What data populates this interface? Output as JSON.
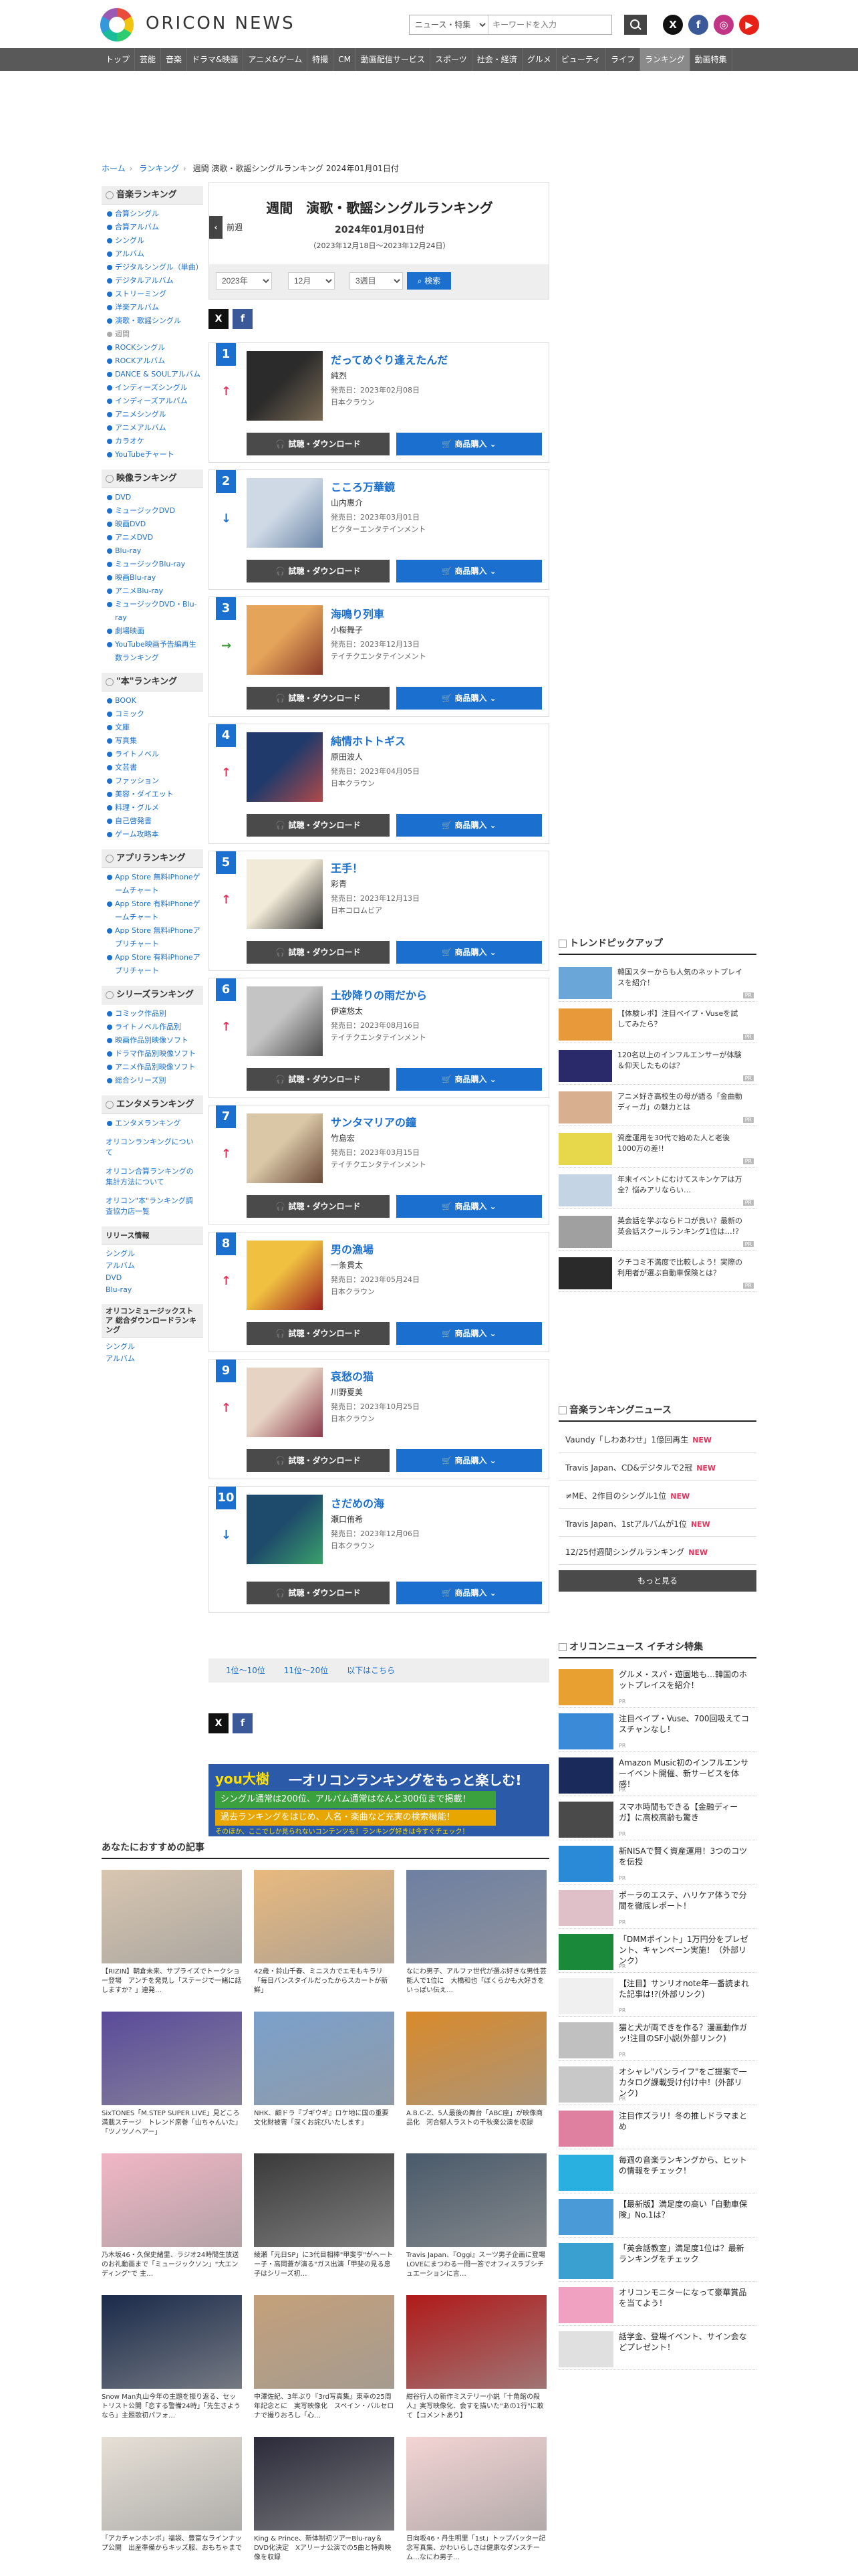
{
  "header": {
    "logo": "ORICON NEWS",
    "search_category": "ニュース・特集",
    "search_placeholder": "キーワードを入力",
    "social": [
      "X",
      "f",
      "◎",
      "▶"
    ]
  },
  "nav": [
    "トップ",
    "芸能",
    "音楽",
    "ドラマ&映画",
    "アニメ&ゲーム",
    "特撮",
    "CM",
    "動画配信サービス",
    "スポーツ",
    "社会・経済",
    "グルメ",
    "ビューティ",
    "ライフ",
    "ランキング",
    "動画特集"
  ],
  "nav_active": "ランキング",
  "breadcrumb": [
    "ホーム",
    "ランキング",
    "週間 演歌・歌謡シングルランキング 2024年01月01日付"
  ],
  "sidebar": {
    "music_head": "音楽ランキング",
    "music": [
      "合算シングル",
      "合算アルバム",
      "シングル",
      "アルバム",
      "デジタルシングル（単曲）",
      "デジタルアルバム",
      "ストリーミング",
      "洋楽アルバム",
      "演歌・歌謡シングル",
      "週間",
      "ROCKシングル",
      "ROCKアルバム",
      "DANCE & SOULアルバム",
      "インディーズシングル",
      "インディーズアルバム",
      "アニメシングル",
      "アニメアルバム",
      "カラオケ",
      "YouTubeチャート"
    ],
    "video_head": "映像ランキング",
    "video": [
      "DVD",
      "ミュージックDVD",
      "映画DVD",
      "アニメDVD",
      "Blu-ray",
      "ミュージックBlu-ray",
      "映画Blu-ray",
      "アニメBlu-ray",
      "ミュージックDVD・Blu-ray",
      "劇場映画",
      "YouTube映画予告編再生数ランキング"
    ],
    "book_head": "\"本\"ランキング",
    "book": [
      "BOOK",
      "コミック",
      "文庫",
      "写真集",
      "ライトノベル",
      "文芸書",
      "ファッション",
      "美容・ダイエット",
      "料理・グルメ",
      "自己啓発書",
      "ゲーム攻略本"
    ],
    "app_head": "アプリランキング",
    "app": [
      "App Store 無料iPhoneゲームチャート",
      "App Store 有料iPhoneゲームチャート",
      "App Store 無料iPhoneアプリチャート",
      "App Store 有料iPhoneアプリチャート"
    ],
    "series_head": "シリーズランキング",
    "series": [
      "コミック作品別",
      "ライトノベル作品別",
      "映画作品別映像ソフト",
      "ドラマ作品別映像ソフト",
      "アニメ作品別映像ソフト",
      "総合シリーズ別"
    ],
    "ent_head": "エンタメランキング",
    "ent": [
      "エンタメランキング"
    ],
    "links": [
      "オリコンランキングについて",
      "オリコン合算ランキングの集計方法について",
      "オリコン\"本\"ランキング調査協力店一覧"
    ],
    "release_head": "リリース情報",
    "release": [
      "シングル",
      "アルバム",
      "DVD",
      "Blu-ray"
    ],
    "music_store_head": "オリコンミュージックストア 総合ダウンロードランキング",
    "music_store": [
      "シングル",
      "アルバム"
    ]
  },
  "main": {
    "title": "週間　演歌・歌謡シングルランキング",
    "date": "2024年01月01日付",
    "range": "（2023年12月18日〜2023年12月24日）",
    "prev": "前週",
    "year": "2023年",
    "month": "12月",
    "week": "3週目",
    "search_btn": "検索",
    "dl_label": "試聴・ダウンロード",
    "buy_label": "商品購入",
    "pager": [
      "1位〜10位",
      "11位〜20位",
      "以下はこちら"
    ]
  },
  "ranking": [
    {
      "rank": "1",
      "title": "だってめぐり逢えたんだ",
      "artist": "純烈",
      "date": "発売日：2023年02月08日",
      "label": "日本クラウン",
      "move": "up"
    },
    {
      "rank": "2",
      "title": "こころ万華鏡",
      "artist": "山内惠介",
      "date": "発売日：2023年03月01日",
      "label": "ビクターエンタテインメント",
      "move": "down"
    },
    {
      "rank": "3",
      "title": "海鳴り列車",
      "artist": "小桜舞子",
      "date": "発売日：2023年12月13日",
      "label": "テイチクエンタテインメント",
      "move": "new"
    },
    {
      "rank": "4",
      "title": "純情ホトトギス",
      "artist": "原田波人",
      "date": "発売日：2023年04月05日",
      "label": "日本クラウン",
      "move": "up"
    },
    {
      "rank": "5",
      "title": "王手！",
      "artist": "彩青",
      "date": "発売日：2023年12月13日",
      "label": "日本コロムビア",
      "move": "up"
    },
    {
      "rank": "6",
      "title": "土砂降りの雨だから",
      "artist": "伊達悠太",
      "date": "発売日：2023年08月16日",
      "label": "テイチクエンタテインメント",
      "move": "up"
    },
    {
      "rank": "7",
      "title": "サンタマリアの鐘",
      "artist": "竹島宏",
      "date": "発売日：2023年03月15日",
      "label": "テイチクエンタテインメント",
      "move": "up"
    },
    {
      "rank": "8",
      "title": "男の漁場",
      "artist": "一条貫太",
      "date": "発売日：2023年05月24日",
      "label": "日本クラウン",
      "move": "up"
    },
    {
      "rank": "9",
      "title": "哀愁の猫",
      "artist": "川野夏美",
      "date": "発売日：2023年10月25日",
      "label": "日本クラウン",
      "move": "up"
    },
    {
      "rank": "10",
      "title": "さだめの海",
      "artist": "瀬口侑希",
      "date": "発売日：2023年12月06日",
      "label": "日本クラウン",
      "move": "down"
    }
  ],
  "banner": {
    "l1": "you大樹",
    "l2": "一オリコンランキングをもっと楽しむ!",
    "l3": "シングル通常は200位、アルバム通常はなんと300位まで掲載！",
    "l4": "過去ランキングをはじめ、人名・楽曲など充実の検索機能！",
    "l5": "そのほか、ここでしか見られないコンテンツも！ランキング好きは今すぐチェック！"
  },
  "recommend": {
    "title": "あなたにおすすめの記事",
    "items": [
      "【RIZIN】朝倉未来、サプライズでトークショー登場　アンチを発見し「ステージで一緒に話しますか？」連発…",
      "42歳・鈴山千春、ミニスカでエモもキラリ「毎日バンスタイルだったからスカートが新鮮」",
      "なにわ男子、アルファ世代が選ぶ好きな男性芸能人で1位に　大橋和也「ぼくらかも大好きをいっぱい伝え…",
      "SixTONES「M.STEP SUPER LIVE」見どころ満載ステージ　トレンド席巻「山ちゃんいた」「ツノツノヘアー」",
      "NHK、顧ドラ『ブギウギ』ロケ地に国の重要文化財被害「深くお詫びいたします」",
      "A.B.C-Z、5人最後の舞台「ABC座」が映像商品化　河合郁人ラストの千秋楽公演を収録",
      "乃木坂46・久保史緒里、ラジオ24時間生放送のお礼動画まで「ミュージックソン」\"大エンディング\"で 主…",
      "綾瀬「元日SP」に3代目相棒\"甲斐亨\"がへートー子・高岡蒼が演る\"ガス出演「甲斐の見る息子はシリーズ初…",
      "Travis Japan、『Oggi』スーツ男子企画に登場　LOVEにまつわる一問一答でオフィスラブシチュエーションに言…",
      "Snow Man丸山今年の主題を振り返る、セットリスト公開「恋する警備24時」「先生さようなら」主題歌初パフォ…",
      "中澤佐紀、3年ぶり『3rd写真集』東幸の25周年記念とに　実写映像化　スペイン・バルセロナで撮りおろし「心…",
      "紺谷行人の新作ミステリー小説『十角館の殺人』実写映像化、会すを描いた\"あの1行\"に敢て【コメントあり】",
      "「アカチャンホンポ」福袋、豊富なラインナップ公開　出産準備からキッズ服、おもちゃまで",
      "King & Prince、新体制初ツアーBlu-ray＆DVD化決定　Xアリーナ公演での5曲と特典映像を収録",
      "日向坂46・丹生明里「1st」トップバッター記念写真集、かわいらしさは健康なダンスチーム…なにわ男子…"
    ]
  },
  "trend": {
    "title": "トレンドピックアップ",
    "items": [
      "韓国スターからも人気のネットプレイスを紹介！",
      "【体験レポ】注目ベイプ・Vuseを試してみたら？",
      "120名以上のインフルエンサーが体験＆仰天したものは？",
      "アニメ好き高校生の母が語る「金曲動ディーガ」の魅力とは",
      "資産運用を30代で始めた人と老後1000万の差!!",
      "年末イベントにむけてスキンケアは万全？悩みアリならい…",
      "英会話を学ぶならドコが良い？最新の英会話スクールランキング1位は…!?",
      "クチコミ不満度で比較しよう！実際の利用者が選ぶ自動車保険とは？"
    ],
    "pr": "PR"
  },
  "news": {
    "title": "音楽ランキングニュース",
    "items": [
      "Vaundy「しわあわせ」1億回再生",
      "Travis Japan、CD&デジタルで2冠",
      "≠ME、2作目のシングル1位",
      "Travis Japan、1stアルバムが1位",
      "12/25付週間シングルランキング"
    ],
    "new": "NEW",
    "more": "もっと見る"
  },
  "feature": {
    "title": "オリコンニュース イチオシ特集",
    "items": [
      "グルメ・スパ・遊園地も…韓国のホットプレイスを紹介！",
      "注目ベイプ・Vuse、700回吸えてコスチャンなし！",
      "Amazon Music初のインフルエンサーイベント開催、新サービスを体感！",
      "スマホ時間もできる【金融ディーガ】に高校高齢も驚き",
      "新NISAで賢く資産運用！3つのコツを伝授",
      "ポーラのエステ、ハリケア体うで分間を徹底レポート！",
      "「DMMポイント」1万円分をプレゼント、キャンペーン実施！（外部リンク）",
      "【注目】サンリオnote年一番読まれた記事は!?(外部リンク)",
      "猫と犬が両できを作る？漫画動作ガッ!注目のSF小説(外部リンク)",
      "オシャレ\"パンライフ\"をご提案で一カタログ課載受け付け中！(外部リンク)",
      "注目作ズラリ！冬の推しドラマまとめ",
      "毎週の音楽ランキングから、ヒットの情報をチェック！",
      "【最新版】満足度の高い「自動車保険」No.1は？",
      "「英会話教室」満足度1位は？最新ランキングをチェック",
      "オリコンモニターになって豪華賞品を当てよう！",
      "話学金、登場イベント、サイン会などプレゼント！"
    ],
    "subs": [
      "PR",
      "PR",
      "PR",
      "PR",
      "PR",
      "PR",
      "PR",
      "PR",
      "PR",
      "PR",
      "",
      "",
      "",
      "",
      "",
      ""
    ]
  }
}
